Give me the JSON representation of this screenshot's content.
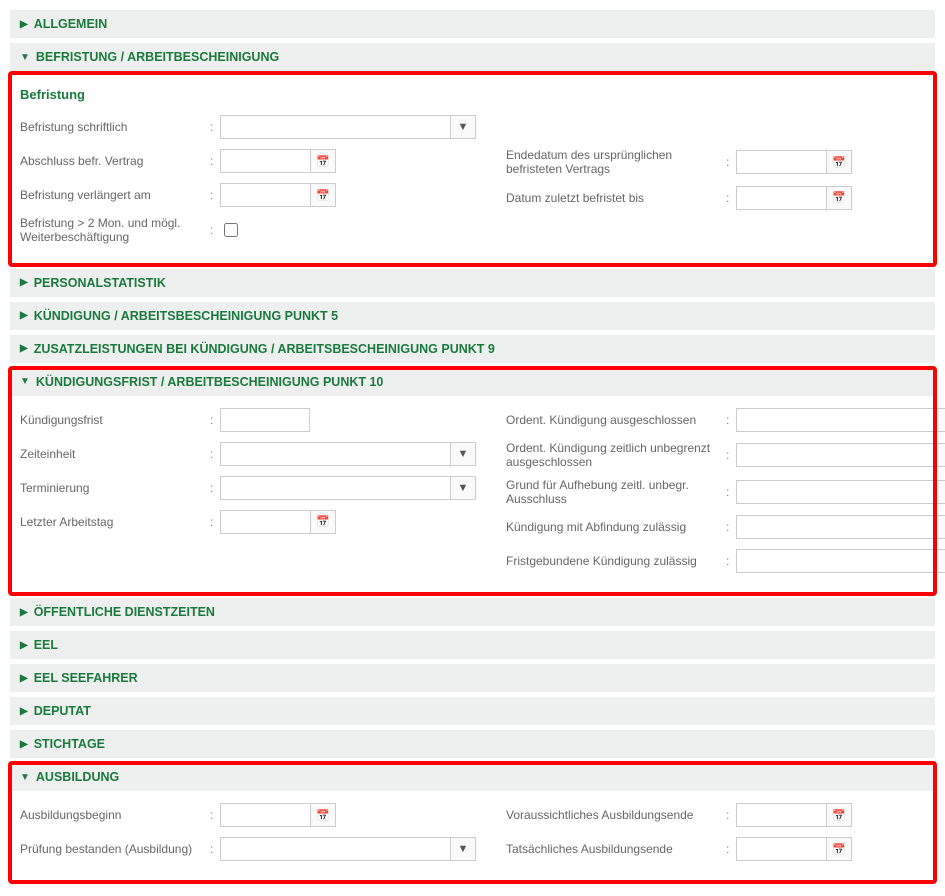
{
  "sections": {
    "allgemein": {
      "title": "ALLGEMEIN",
      "expanded": false
    },
    "befristung": {
      "title": "BEFRISTUNG / ARBEITBESCHEINIGUNG",
      "expanded": true,
      "subtitle": "Befristung",
      "left": {
        "schriftlich": "Befristung schriftlich",
        "abschluss": "Abschluss befr. Vertrag",
        "verlaengert": "Befristung verlängert am",
        "zweimon": "Befristung > 2 Mon. und mögl. Weiterbeschäftigung"
      },
      "right": {
        "endedatum": "Endedatum des ursprünglichen befristeten Vertrags",
        "zuletzt": "Datum zuletzt befristet bis"
      }
    },
    "personalstatistik": {
      "title": "PERSONALSTATISTIK",
      "expanded": false
    },
    "kuendigung5": {
      "title": "KÜNDIGUNG / ARBEITSBESCHEINIGUNG PUNKT 5",
      "expanded": false
    },
    "zusatz9": {
      "title": "ZUSATZLEISTUNGEN BEI KÜNDIGUNG / ARBEITSBESCHEINIGUNG PUNKT 9",
      "expanded": false
    },
    "kuendigungsfrist10": {
      "title": "KÜNDIGUNGSFRIST / ARBEITBESCHEINIGUNG PUNKT 10",
      "expanded": true,
      "left": {
        "frist": "Kündigungsfrist",
        "zeiteinheit": "Zeiteinheit",
        "terminierung": "Terminierung",
        "letzter": "Letzter Arbeitstag"
      },
      "right": {
        "ordent_ausgeschlossen": "Ordent. Kündigung ausgeschlossen",
        "ordent_zeitlich": "Ordent. Kündigung zeitlich unbegrenzt ausgeschlossen",
        "grund_aufhebung": "Grund für Aufhebung zeitl. unbegr. Ausschluss",
        "abfindung": "Kündigung mit Abfindung zulässig",
        "fristgebunden": "Fristgebundene Kündigung zulässig"
      }
    },
    "oeffentliche": {
      "title": "ÖFFENTLICHE DIENSTZEITEN",
      "expanded": false
    },
    "eel": {
      "title": "EEL",
      "expanded": false
    },
    "eel_seefahrer": {
      "title": "EEL SEEFAHRER",
      "expanded": false
    },
    "deputat": {
      "title": "DEPUTAT",
      "expanded": false
    },
    "stichtage": {
      "title": "STICHTAGE",
      "expanded": false
    },
    "ausbildung": {
      "title": "AUSBILDUNG",
      "expanded": true,
      "left": {
        "beginn": "Ausbildungsbeginn",
        "pruefung": "Prüfung bestanden (Ausbildung)"
      },
      "right": {
        "voraussichtlich": "Voraussichtliches Ausbildungsende",
        "tatsaechlich": "Tatsächliches Ausbildungsende"
      }
    }
  },
  "icons": {
    "calendar": "📅",
    "dropdown": "▼",
    "collapsed": "▶",
    "expanded": "▼"
  }
}
